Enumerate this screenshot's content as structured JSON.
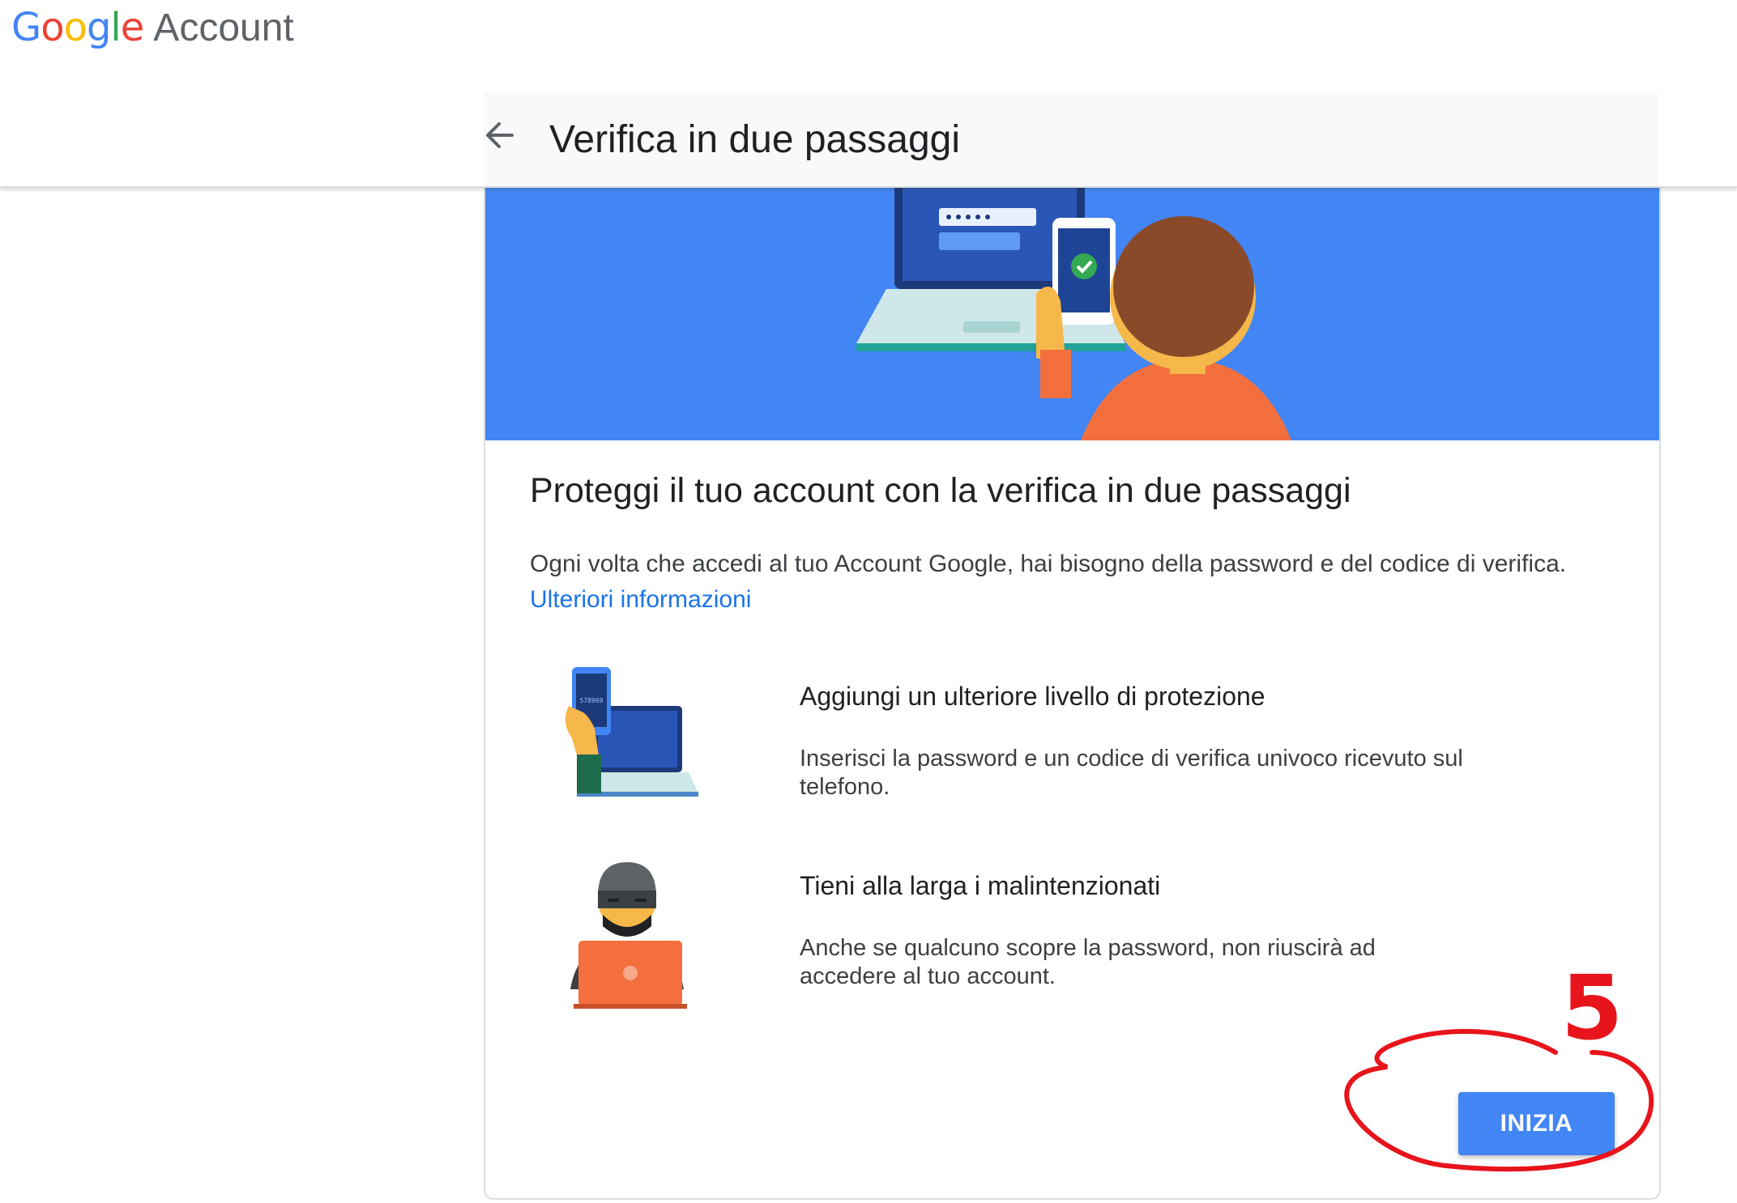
{
  "brand": {
    "logo_letters": [
      {
        "char": "G",
        "color": "#4285F4"
      },
      {
        "char": "o",
        "color": "#EA4335"
      },
      {
        "char": "o",
        "color": "#FBBC05"
      },
      {
        "char": "g",
        "color": "#4285F4"
      },
      {
        "char": "l",
        "color": "#34A853"
      },
      {
        "char": "e",
        "color": "#EA4335"
      }
    ],
    "product": "Account"
  },
  "header": {
    "title": "Verifica in due passaggi",
    "back_icon": "arrow-back-icon"
  },
  "main": {
    "hero_color": "#4285f4",
    "title": "Proteggi il tuo account con la verifica in due passaggi",
    "description": "Ogni volta che accedi al tuo Account Google, hai bisogno della password e del codice di verifica.",
    "learn_more": "Ulteriori informazioni",
    "features": [
      {
        "title": "Aggiungi un ulteriore livello di protezione",
        "text": "Inserisci la password e un codice di verifica univoco ricevuto sul telefono.",
        "phone_code": "578969",
        "icon": "phone-laptop-icon"
      },
      {
        "title": "Tieni alla larga i malintenzionati",
        "text": "Anche se qualcuno scopre la password, non riuscirà ad accedere al tuo account.",
        "icon": "hacker-icon"
      }
    ],
    "start_button": "INIZIA"
  },
  "annotation": {
    "number": "5",
    "color": "#e8141b"
  }
}
